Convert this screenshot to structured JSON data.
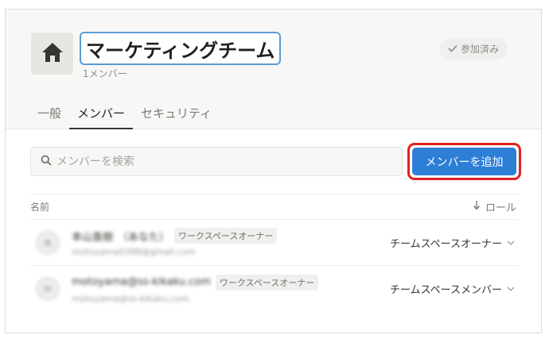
{
  "header": {
    "title": "マーケティングチーム",
    "member_count": "1メンバー",
    "joined_label": "参加済み"
  },
  "tabs": [
    {
      "label": "一般",
      "active": false
    },
    {
      "label": "メンバー",
      "active": true
    },
    {
      "label": "セキュリティ",
      "active": false
    }
  ],
  "search": {
    "placeholder": "メンバーを検索",
    "value": ""
  },
  "add_member_label": "メンバーを追加",
  "table": {
    "name_header": "名前",
    "role_header": "ロール",
    "rows": [
      {
        "avatar": "本",
        "name": "本山直樹",
        "name_extra": "（あなた）",
        "email": "motoyama0398@gmail.com",
        "workspace_role": "ワークスペースオーナー",
        "team_role": "チームスペースオーナー"
      },
      {
        "avatar": "M",
        "name": "motoyama@ss-kikaku.com",
        "email": "motoyama@ss-kikaku.com",
        "workspace_role": "ワークスペースオーナー",
        "team_role": "チームスペースメンバー"
      }
    ]
  },
  "colors": {
    "accent": "#2d7fd6",
    "highlight": "#e02020",
    "focus_ring": "#5a9bd5"
  }
}
